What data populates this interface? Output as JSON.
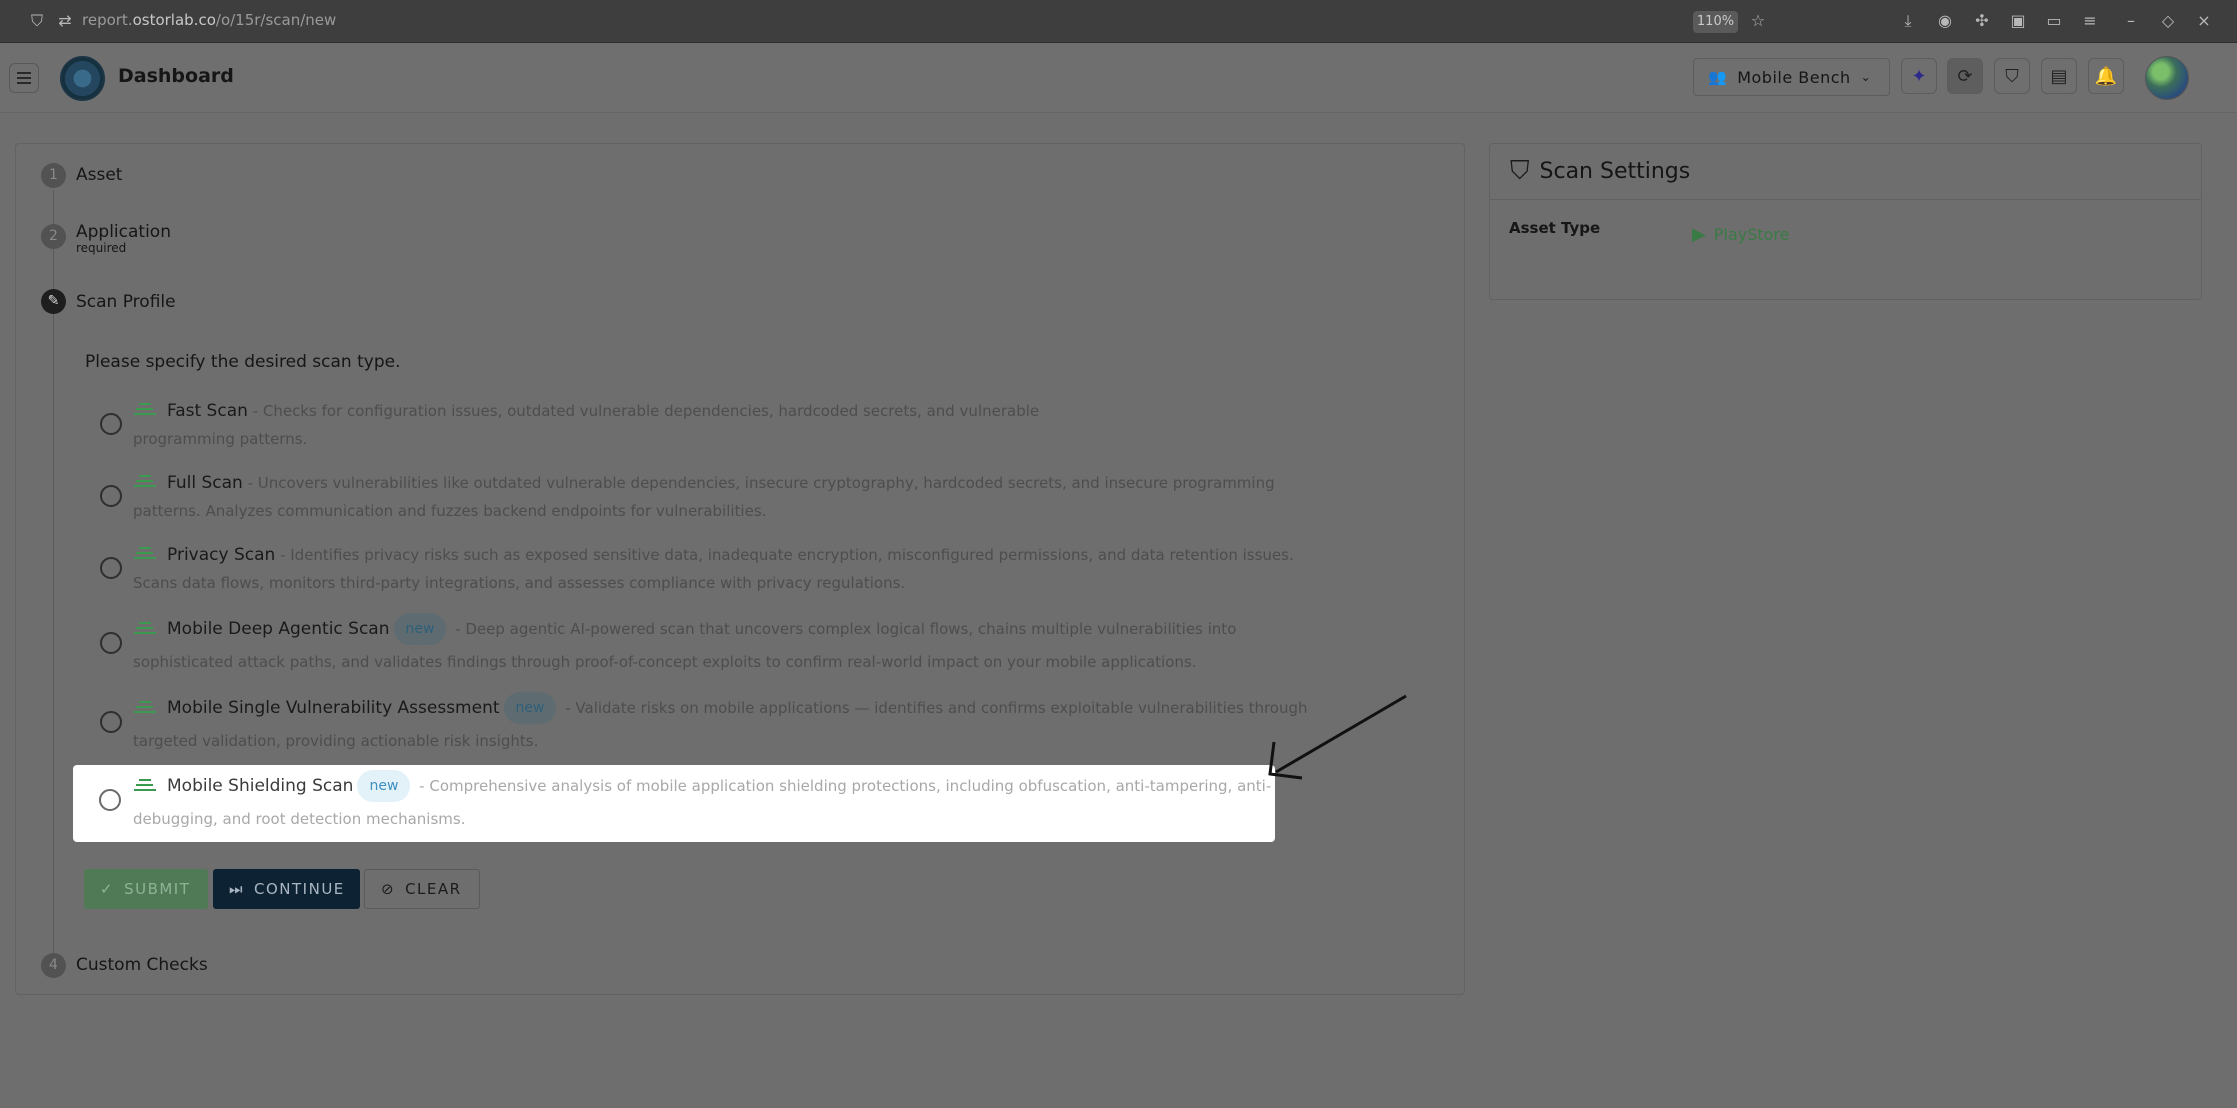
{
  "browser": {
    "url_prefix": "report.",
    "url_domain": "ostorlab.co",
    "url_path": "/o/15r/scan/new",
    "zoom": "110%"
  },
  "header": {
    "title": "Dashboard",
    "org_name": "Mobile Bench"
  },
  "steps": [
    {
      "number": "1",
      "label": "Asset"
    },
    {
      "number": "2",
      "label": "Application",
      "sub": "required"
    },
    {
      "number": "",
      "label": "Scan Profile"
    },
    {
      "number": "4",
      "label": "Custom Checks"
    }
  ],
  "prompt": "Please specify the desired scan type.",
  "options": [
    {
      "title": "Fast Scan",
      "desc": " - Checks for configuration issues, outdated vulnerable dependencies, hardcoded secrets, and vulnerable",
      "line2": "programming patterns."
    },
    {
      "title": "Full Scan",
      "desc": " - Uncovers vulnerabilities like outdated vulnerable dependencies, insecure cryptography, hardcoded secrets, and insecure programming",
      "line2": "patterns. Analyzes communication and fuzzes backend endpoints for vulnerabilities."
    },
    {
      "title": "Privacy Scan",
      "desc": " - Identifies privacy risks such as exposed sensitive data, inadequate encryption, misconfigured permissions, and data retention issues.",
      "line2": "Scans data flows, monitors third-party integrations, and assesses compliance with privacy regulations."
    },
    {
      "title": "Mobile Deep Agentic Scan",
      "badge": "new",
      "desc": " - Deep agentic AI-powered scan that uncovers complex logical flows, chains multiple vulnerabilities into",
      "line2": "sophisticated attack paths, and validates findings through proof-of-concept exploits to confirm real-world impact on your mobile applications."
    },
    {
      "title": "Mobile Single Vulnerability Assessment",
      "badge": "new",
      "desc": " - Validate risks on mobile applications — identifies and confirms exploitable vulnerabilities through",
      "line2": "targeted validation, providing actionable risk insights."
    },
    {
      "title": "Mobile Shielding Scan",
      "badge": "new",
      "desc": " - Comprehensive analysis of mobile application shielding protections, including obfuscation, anti-tampering, anti-",
      "line2": "debugging, and root detection mechanisms."
    }
  ],
  "buttons": {
    "submit": "SUBMIT",
    "continue": "CONTINUE",
    "clear": "CLEAR"
  },
  "settings": {
    "title": "Scan Settings",
    "asset_type_label": "Asset Type",
    "asset_type_value": "PlayStore"
  },
  "colors": {
    "accent_green": "#3b9a4f",
    "continue_bg": "#0d2233",
    "badge_bg": "#e3f1f9"
  }
}
